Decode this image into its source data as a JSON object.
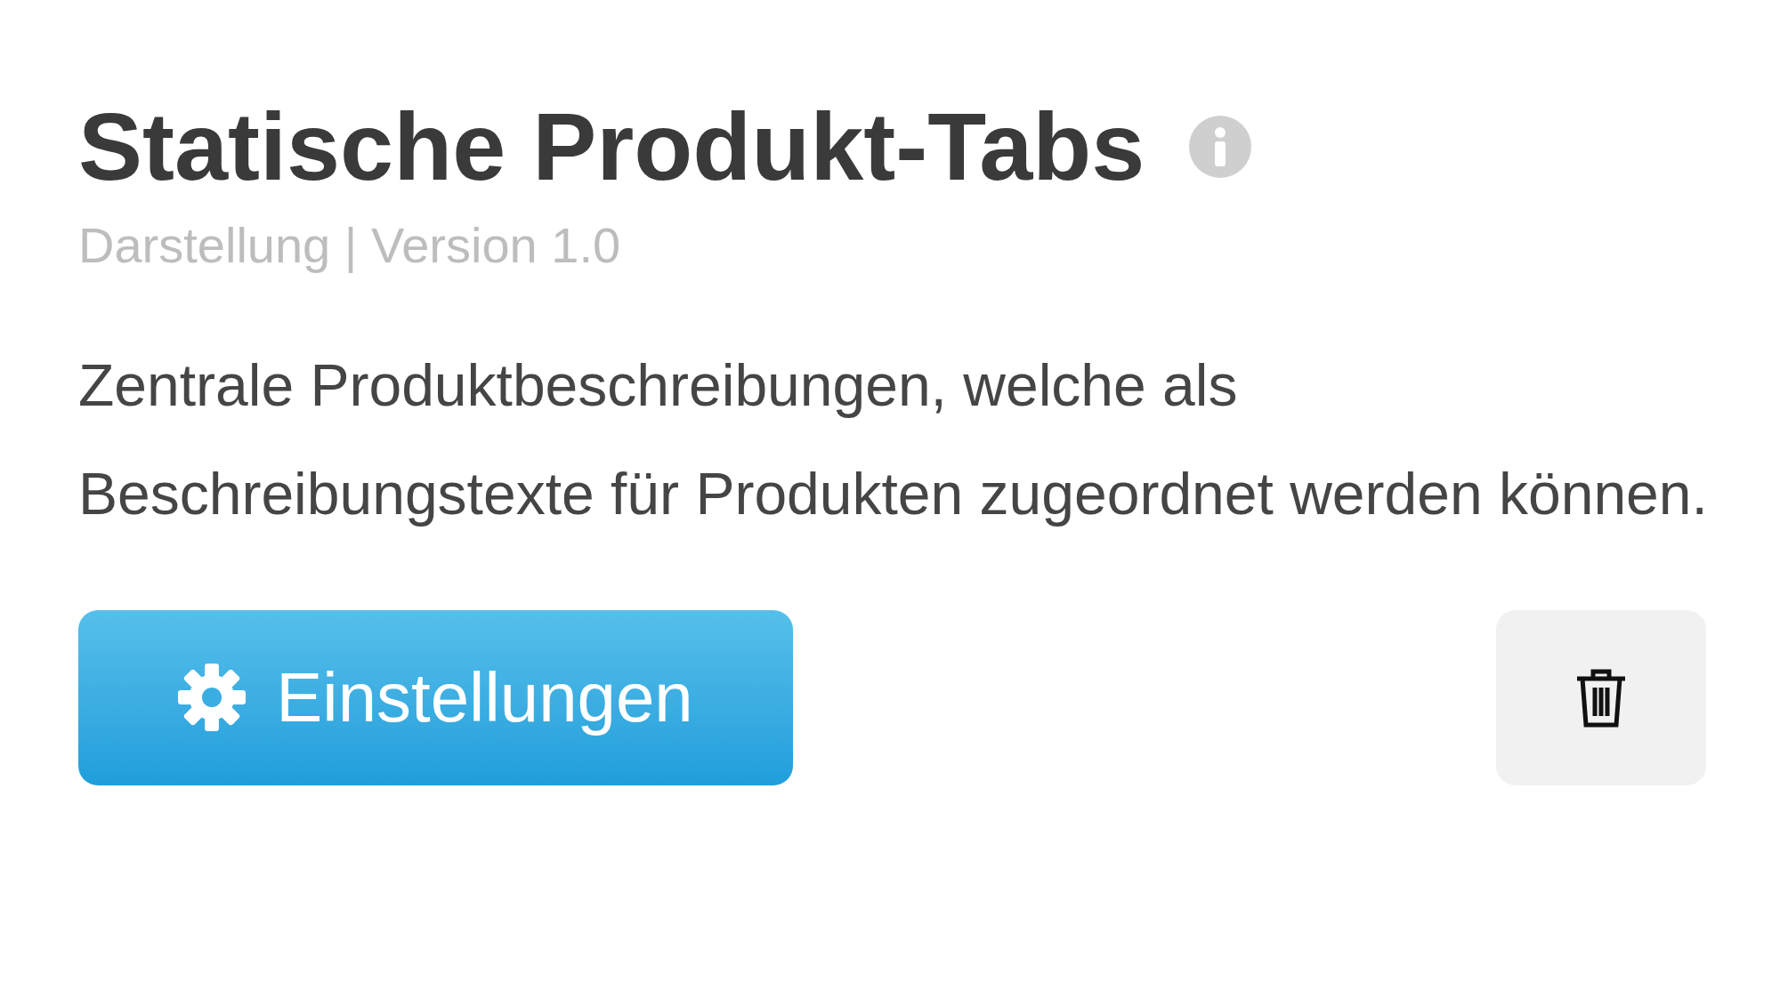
{
  "plugin": {
    "title": "Statische Produkt-Tabs",
    "meta": "Darstellung | Version 1.0",
    "description": "Zentrale Produktbeschreibungen, welche als Beschreibungstexte für Produkten zugeordnet werden können.",
    "settings_button": "Einstellungen"
  }
}
